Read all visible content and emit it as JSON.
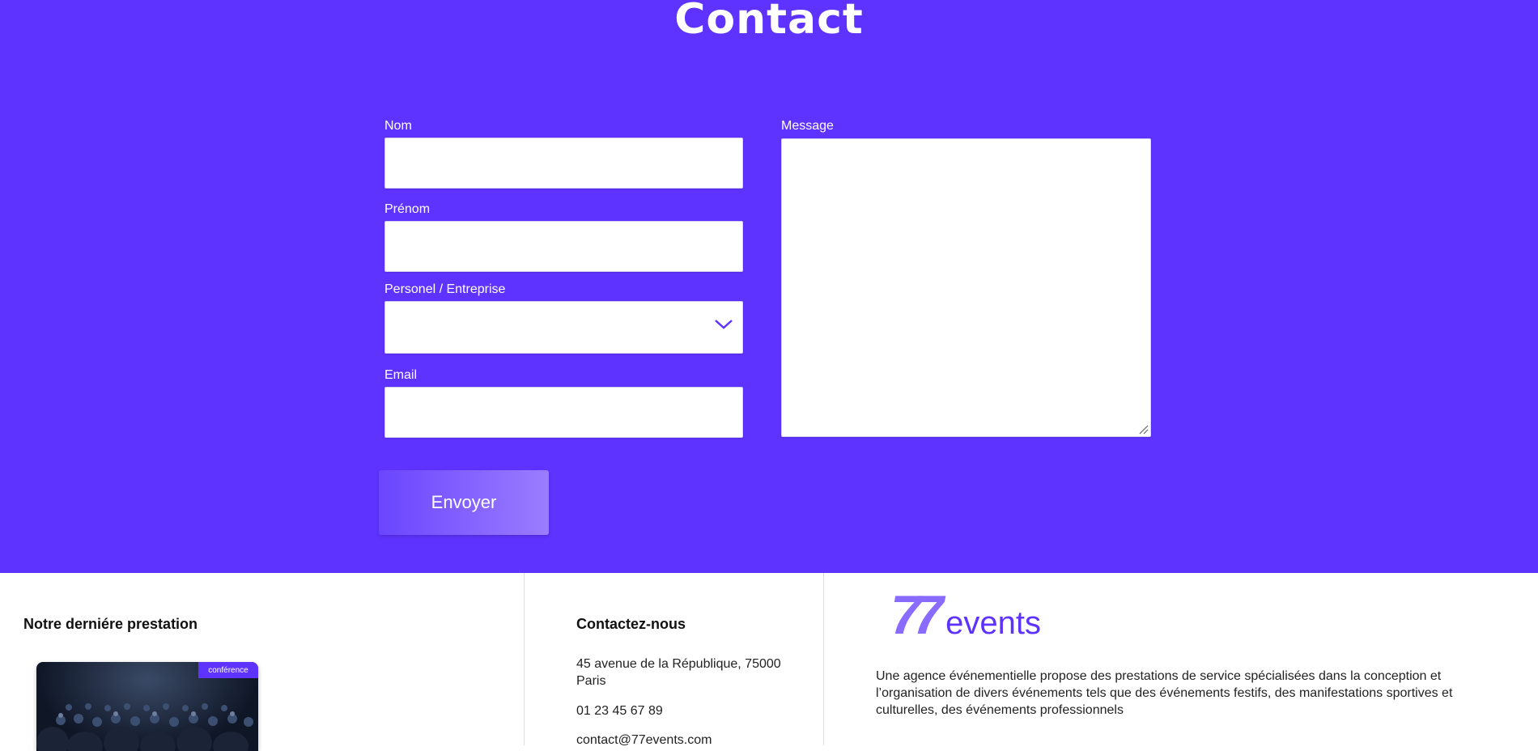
{
  "page": {
    "title": "Contact"
  },
  "form": {
    "nom_label": "Nom",
    "nom_value": "",
    "prenom_label": "Prénom",
    "prenom_value": "",
    "type_label": "Personel / Entreprise",
    "type_value": "",
    "email_label": "Email",
    "email_value": "",
    "message_label": "Message",
    "message_value": "",
    "submit_label": "Envoyer"
  },
  "footer": {
    "prestation": {
      "heading": "Notre derniére prestation",
      "badge": "conférence"
    },
    "contact": {
      "heading": "Contactez-nous",
      "address": "45 avenue de la République, 75000 Paris",
      "phone": "01 23 45 67 89",
      "email": "contact@77events.com"
    },
    "brand": {
      "logo_number": "77",
      "logo_word": "events",
      "description": "Une agence événementielle propose des prestations de service spécialisées dans la conception et l’organisation de divers événements tels que des événements festifs, des manifestations sportives et culturelles, des événements professionnels"
    }
  },
  "colors": {
    "primary": "#5e33ff",
    "white": "#ffffff",
    "logo_light": "#8a6bff"
  },
  "icons": {
    "select": "chevron-down-icon",
    "resize": "resize-grip-icon"
  }
}
